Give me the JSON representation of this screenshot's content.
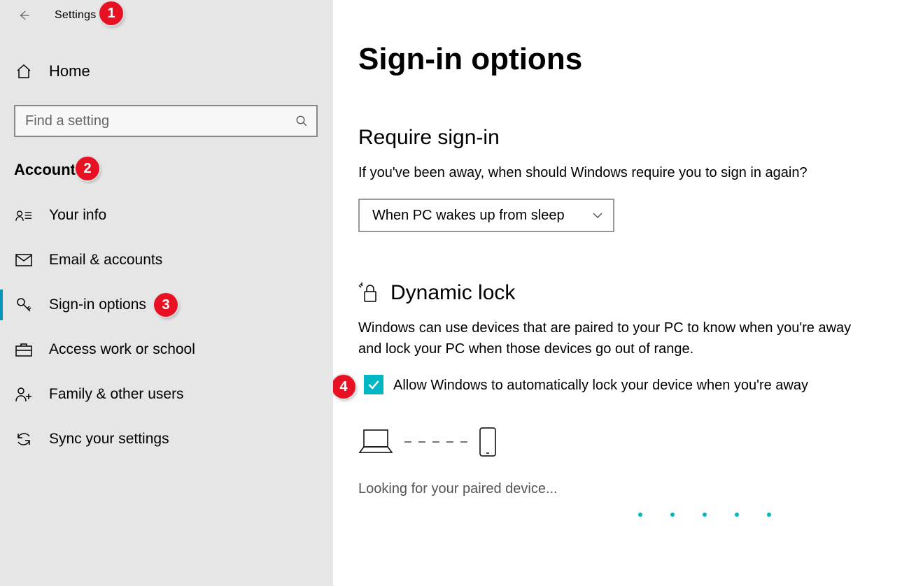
{
  "titlebar": {
    "app_name": "Settings"
  },
  "sidebar": {
    "home_label": "Home",
    "search_placeholder": "Find a setting",
    "category_label": "Accounts",
    "items": [
      {
        "label": "Your info"
      },
      {
        "label": "Email & accounts"
      },
      {
        "label": "Sign-in options"
      },
      {
        "label": "Access work or school"
      },
      {
        "label": "Family & other users"
      },
      {
        "label": "Sync your settings"
      }
    ]
  },
  "main": {
    "page_title": "Sign-in options",
    "require": {
      "heading": "Require sign-in",
      "prompt": "If you've been away, when should Windows require you to sign in again?",
      "selected": "When PC wakes up from sleep"
    },
    "dynamic_lock": {
      "heading": "Dynamic lock",
      "description": "Windows can use devices that are paired to your PC to know when you're away and lock your PC when those devices go out of range.",
      "checkbox_label": "Allow Windows to automatically lock your device when you're away",
      "checkbox_checked": true,
      "status": "Looking for your paired device..."
    }
  },
  "annotations": [
    "1",
    "2",
    "3",
    "4"
  ]
}
